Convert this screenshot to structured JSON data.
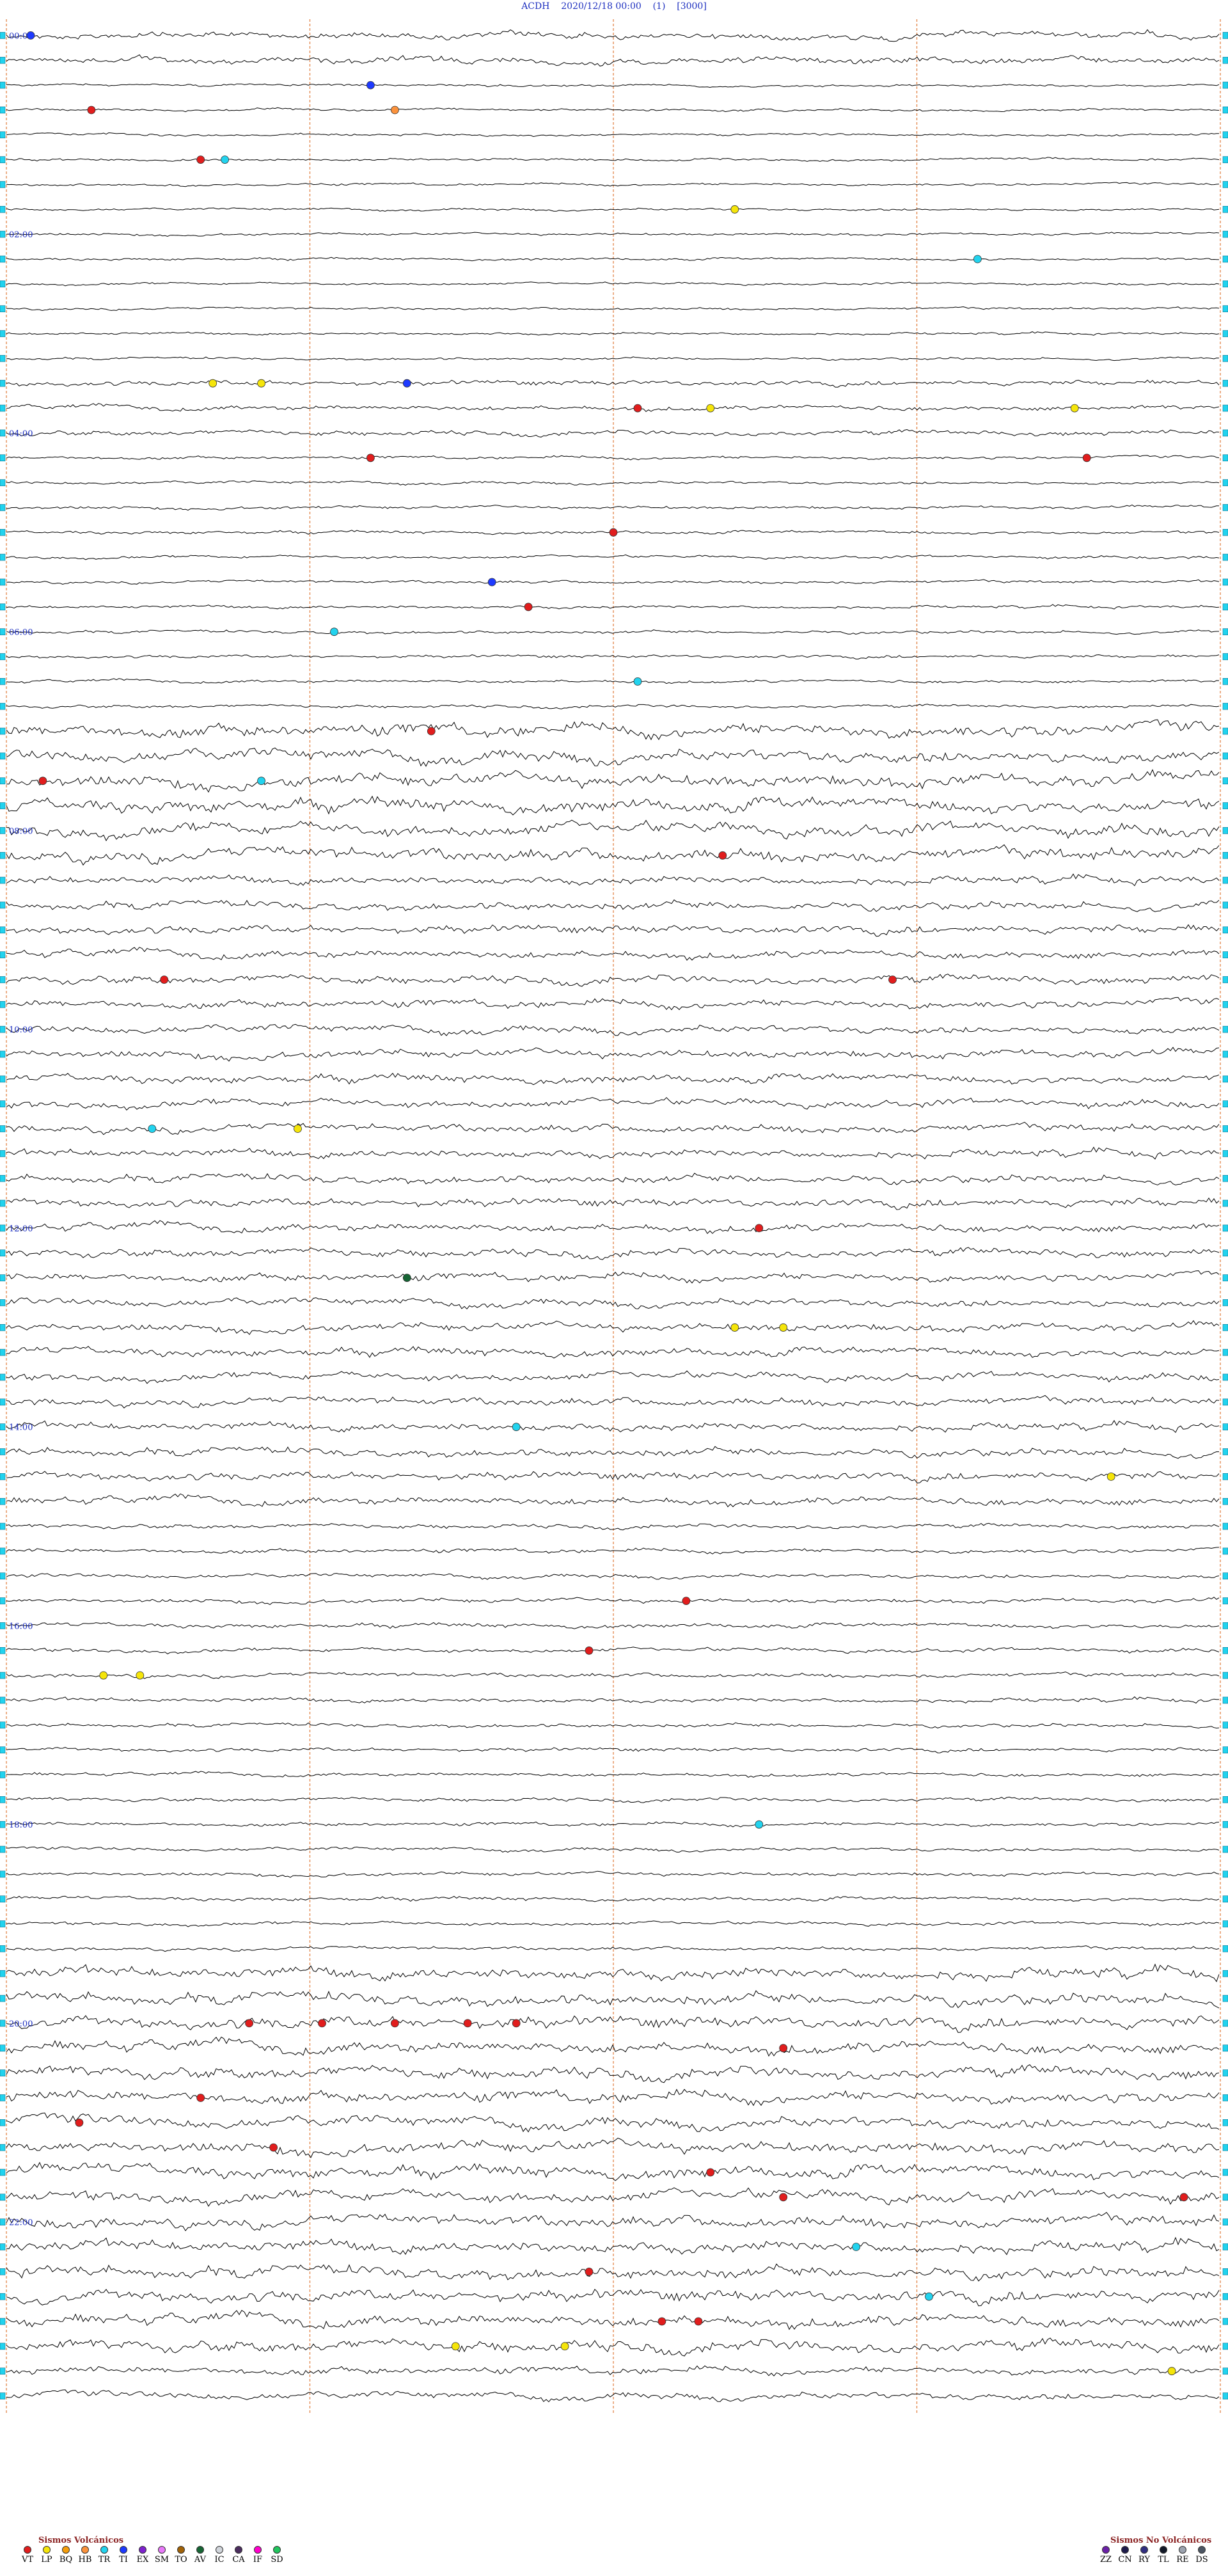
{
  "header": {
    "station": "ACDH",
    "datetime": "2020/12/18 00:00",
    "channel": "(1)",
    "scale": "[3000]"
  },
  "chart_data": {
    "type": "line",
    "title": "ACDH 2020/12/18 00:00 (1) [3000]",
    "x": {
      "range_minutes": [
        0,
        60
      ],
      "gridlines_minutes": [
        0,
        15,
        30,
        45,
        60
      ]
    },
    "y": {
      "traces": 96,
      "trace_interval_minutes": 15
    },
    "time_labels": [
      "00:00",
      "02:00",
      "04:00",
      "06:00",
      "08:00",
      "10:00",
      "12:00",
      "14:00",
      "16:00",
      "18:00",
      "20:00",
      "22:00"
    ],
    "series": [
      {
        "values": [
          {
            "t": 0.02,
            "trace": 0,
            "cat": "TI"
          },
          {
            "t": 0.3,
            "trace": 2,
            "cat": "TI"
          },
          {
            "t": 0.07,
            "trace": 3,
            "cat": "VT"
          },
          {
            "t": 0.16,
            "trace": 5,
            "cat": "VT"
          },
          {
            "t": 0.18,
            "trace": 5,
            "cat": "TR"
          },
          {
            "t": 0.32,
            "trace": 3,
            "cat": "HB"
          },
          {
            "t": 0.6,
            "trace": 7,
            "cat": "LP"
          },
          {
            "t": 0.8,
            "trace": 9,
            "cat": "TR"
          },
          {
            "t": 0.17,
            "trace": 14,
            "cat": "LP"
          },
          {
            "t": 0.21,
            "trace": 14,
            "cat": "LP"
          },
          {
            "t": 0.33,
            "trace": 14,
            "cat": "TI"
          },
          {
            "t": 0.52,
            "trace": 15,
            "cat": "VT"
          },
          {
            "t": 0.58,
            "trace": 15,
            "cat": "LP"
          },
          {
            "t": 0.88,
            "trace": 15,
            "cat": "LP"
          },
          {
            "t": 0.3,
            "trace": 17,
            "cat": "VT"
          },
          {
            "t": 0.89,
            "trace": 17,
            "cat": "VT"
          },
          {
            "t": 0.5,
            "trace": 20,
            "cat": "VT"
          },
          {
            "t": 0.4,
            "trace": 22,
            "cat": "TI"
          },
          {
            "t": 0.43,
            "trace": 23,
            "cat": "VT"
          },
          {
            "t": 0.27,
            "trace": 24,
            "cat": "TR"
          },
          {
            "t": 0.52,
            "trace": 26,
            "cat": "TR"
          },
          {
            "t": 0.35,
            "trace": 28,
            "cat": "VT"
          },
          {
            "t": 0.21,
            "trace": 30,
            "cat": "TR"
          },
          {
            "t": 0.03,
            "trace": 30,
            "cat": "VT"
          },
          {
            "t": 0.59,
            "trace": 33,
            "cat": "VT"
          },
          {
            "t": 0.73,
            "trace": 38,
            "cat": "VT"
          },
          {
            "t": 0.13,
            "trace": 38,
            "cat": "VT"
          },
          {
            "t": 0.12,
            "trace": 44,
            "cat": "TR"
          },
          {
            "t": 0.24,
            "trace": 44,
            "cat": "LP"
          },
          {
            "t": 0.62,
            "trace": 48,
            "cat": "VT"
          },
          {
            "t": 0.33,
            "trace": 50,
            "cat": "AV"
          },
          {
            "t": 0.6,
            "trace": 52,
            "cat": "LP"
          },
          {
            "t": 0.64,
            "trace": 52,
            "cat": "LP"
          },
          {
            "t": 0.42,
            "trace": 56,
            "cat": "TR"
          },
          {
            "t": 0.91,
            "trace": 58,
            "cat": "LP"
          },
          {
            "t": 0.56,
            "trace": 63,
            "cat": "VT"
          },
          {
            "t": 0.48,
            "trace": 65,
            "cat": "VT"
          },
          {
            "t": 0.11,
            "trace": 66,
            "cat": "LP"
          },
          {
            "t": 0.08,
            "trace": 66,
            "cat": "LP"
          },
          {
            "t": 0.62,
            "trace": 72,
            "cat": "TR"
          },
          {
            "t": 0.2,
            "trace": 80,
            "cat": "VT"
          },
          {
            "t": 0.26,
            "trace": 80,
            "cat": "VT"
          },
          {
            "t": 0.32,
            "trace": 80,
            "cat": "VT"
          },
          {
            "t": 0.38,
            "trace": 80,
            "cat": "VT"
          },
          {
            "t": 0.42,
            "trace": 80,
            "cat": "VT"
          },
          {
            "t": 0.64,
            "trace": 81,
            "cat": "VT"
          },
          {
            "t": 0.16,
            "trace": 83,
            "cat": "VT"
          },
          {
            "t": 0.06,
            "trace": 84,
            "cat": "VT"
          },
          {
            "t": 0.22,
            "trace": 85,
            "cat": "VT"
          },
          {
            "t": 0.58,
            "trace": 86,
            "cat": "VT"
          },
          {
            "t": 0.64,
            "trace": 87,
            "cat": "VT"
          },
          {
            "t": 0.97,
            "trace": 87,
            "cat": "VT"
          },
          {
            "t": 0.7,
            "trace": 89,
            "cat": "TR"
          },
          {
            "t": 0.48,
            "trace": 90,
            "cat": "VT"
          },
          {
            "t": 0.76,
            "trace": 91,
            "cat": "TR"
          },
          {
            "t": 0.54,
            "trace": 92,
            "cat": "VT"
          },
          {
            "t": 0.57,
            "trace": 92,
            "cat": "VT"
          },
          {
            "t": 0.37,
            "trace": 93,
            "cat": "LP"
          },
          {
            "t": 0.46,
            "trace": 93,
            "cat": "LP"
          },
          {
            "t": 0.96,
            "trace": 94,
            "cat": "LP"
          }
        ]
      }
    ]
  },
  "legend_volcanic": {
    "title": "Sismos Volcánicos",
    "items": [
      {
        "code": "VT",
        "color": "#e11d1d"
      },
      {
        "code": "LP",
        "color": "#f5e50a"
      },
      {
        "code": "BQ",
        "color": "#f59e0b"
      },
      {
        "code": "HB",
        "color": "#fb923c"
      },
      {
        "code": "TR",
        "color": "#22d3ee"
      },
      {
        "code": "TI",
        "color": "#1e3aff"
      },
      {
        "code": "EX",
        "color": "#7e22ce"
      },
      {
        "code": "SM",
        "color": "#e879f9"
      },
      {
        "code": "TO",
        "color": "#a16207"
      },
      {
        "code": "AV",
        "color": "#166534"
      },
      {
        "code": "IC",
        "color": "#d1d5db"
      },
      {
        "code": "CA",
        "color": "#4b2d5e"
      },
      {
        "code": "IF",
        "color": "#ff00cc"
      },
      {
        "code": "SD",
        "color": "#22c55e"
      }
    ]
  },
  "legend_nonvolcanic": {
    "title": "Sismos No Volcánicos",
    "items": [
      {
        "code": "ZZ",
        "color": "#6b21a8"
      },
      {
        "code": "CN",
        "color": "#1e1b4b"
      },
      {
        "code": "RY",
        "color": "#312e81"
      },
      {
        "code": "TL",
        "color": "#111827"
      },
      {
        "code": "RE",
        "color": "#9ca3af"
      },
      {
        "code": "DS",
        "color": "#4b5563"
      }
    ]
  }
}
